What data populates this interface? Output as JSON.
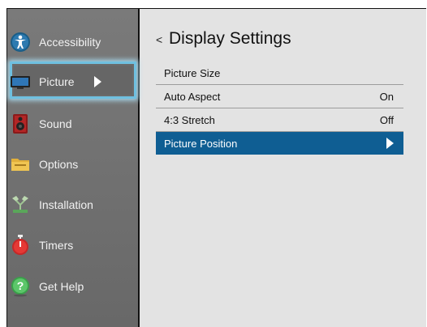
{
  "sidebar": {
    "items": [
      {
        "label": "Accessibility",
        "icon": "accessibility-icon"
      },
      {
        "label": "Picture",
        "icon": "tv-monitor-icon"
      },
      {
        "label": "Sound",
        "icon": "speaker-icon"
      },
      {
        "label": "Options",
        "icon": "folder-icon"
      },
      {
        "label": "Installation",
        "icon": "network-icon"
      },
      {
        "label": "Timers",
        "icon": "stopwatch-icon"
      },
      {
        "label": "Get Help",
        "icon": "help-icon"
      }
    ],
    "selected": "Picture"
  },
  "main": {
    "back_glyph": "<",
    "title": "Display Settings",
    "rows": [
      {
        "label": "Picture Size",
        "value": ""
      },
      {
        "label": "Auto Aspect",
        "value": "On"
      },
      {
        "label": "4:3 Stretch",
        "value": "Off"
      },
      {
        "label": "Picture Position",
        "value": ""
      }
    ]
  },
  "colors": {
    "accent": "#0f5e93",
    "focus_outline": "#6fc0e0",
    "sidebar_bg": "#747474",
    "main_bg": "#e3e3e3"
  }
}
